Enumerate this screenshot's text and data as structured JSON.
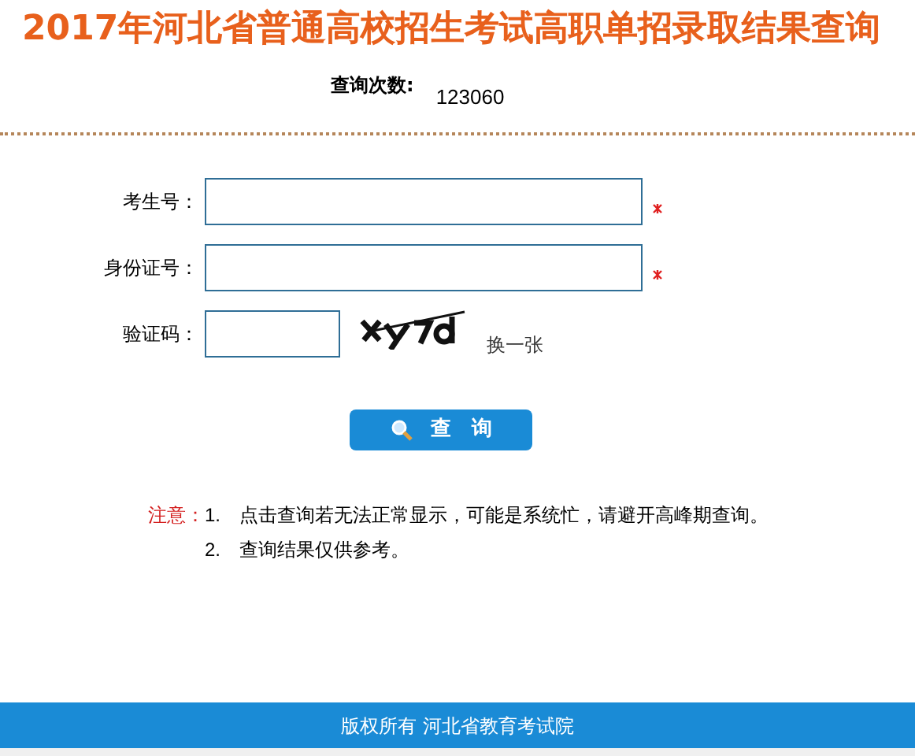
{
  "title": "2017年河北省普通高校招生考试高职单招录取结果查询",
  "query_count": {
    "label": "查询次数:",
    "value": "123060"
  },
  "fields": [
    {
      "kind": "text",
      "label": "考生号：",
      "required": true
    },
    {
      "kind": "text",
      "label": "身份证号：",
      "required": true
    },
    {
      "kind": "captcha",
      "label": "验证码：",
      "required": false,
      "refresh": "换一张"
    }
  ],
  "submit_button": {
    "label": "查　询"
  },
  "notice": {
    "label": "注意：",
    "items": [
      {
        "number": "1.",
        "text": "点击查询若无法正常显示，可能是系统忙，请避开高峰期查询。"
      },
      {
        "number": "2.",
        "text": "查询结果仅供参考。"
      }
    ]
  },
  "footer": {
    "text": "版权所有 河北省教育考试院"
  }
}
